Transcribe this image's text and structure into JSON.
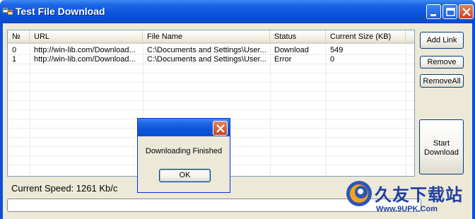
{
  "window": {
    "title": "Test File Download"
  },
  "list": {
    "columns": [
      "№",
      "URL",
      "File Name",
      "Status",
      "Current Size (KB)"
    ],
    "rows": [
      [
        "0",
        "http://win-lib.com/Download...",
        "C:\\Documents and Settings\\User...",
        "Download",
        "549"
      ],
      [
        "1",
        "http://win-lib.com/Download...",
        "C:\\Documents and Settings\\User...",
        "Error",
        "0"
      ]
    ]
  },
  "buttons": {
    "add_link": "Add Link",
    "remove": "Remove",
    "remove_all": "RemoveAll",
    "start_line1": "Start",
    "start_line2": "Download"
  },
  "status": {
    "speed_label": "Current Speed:",
    "speed_value": "1261 Kb/c"
  },
  "progress": {
    "value": 0
  },
  "dialog": {
    "message": "Downloading Finished",
    "ok_label": "OK"
  },
  "watermark": {
    "brand": "久友下载站",
    "url": "Www.9UPK.Com"
  },
  "colors": {
    "title_bar": "#0b55db",
    "window_face": "#ece9d8",
    "close_button": "#c84420"
  }
}
